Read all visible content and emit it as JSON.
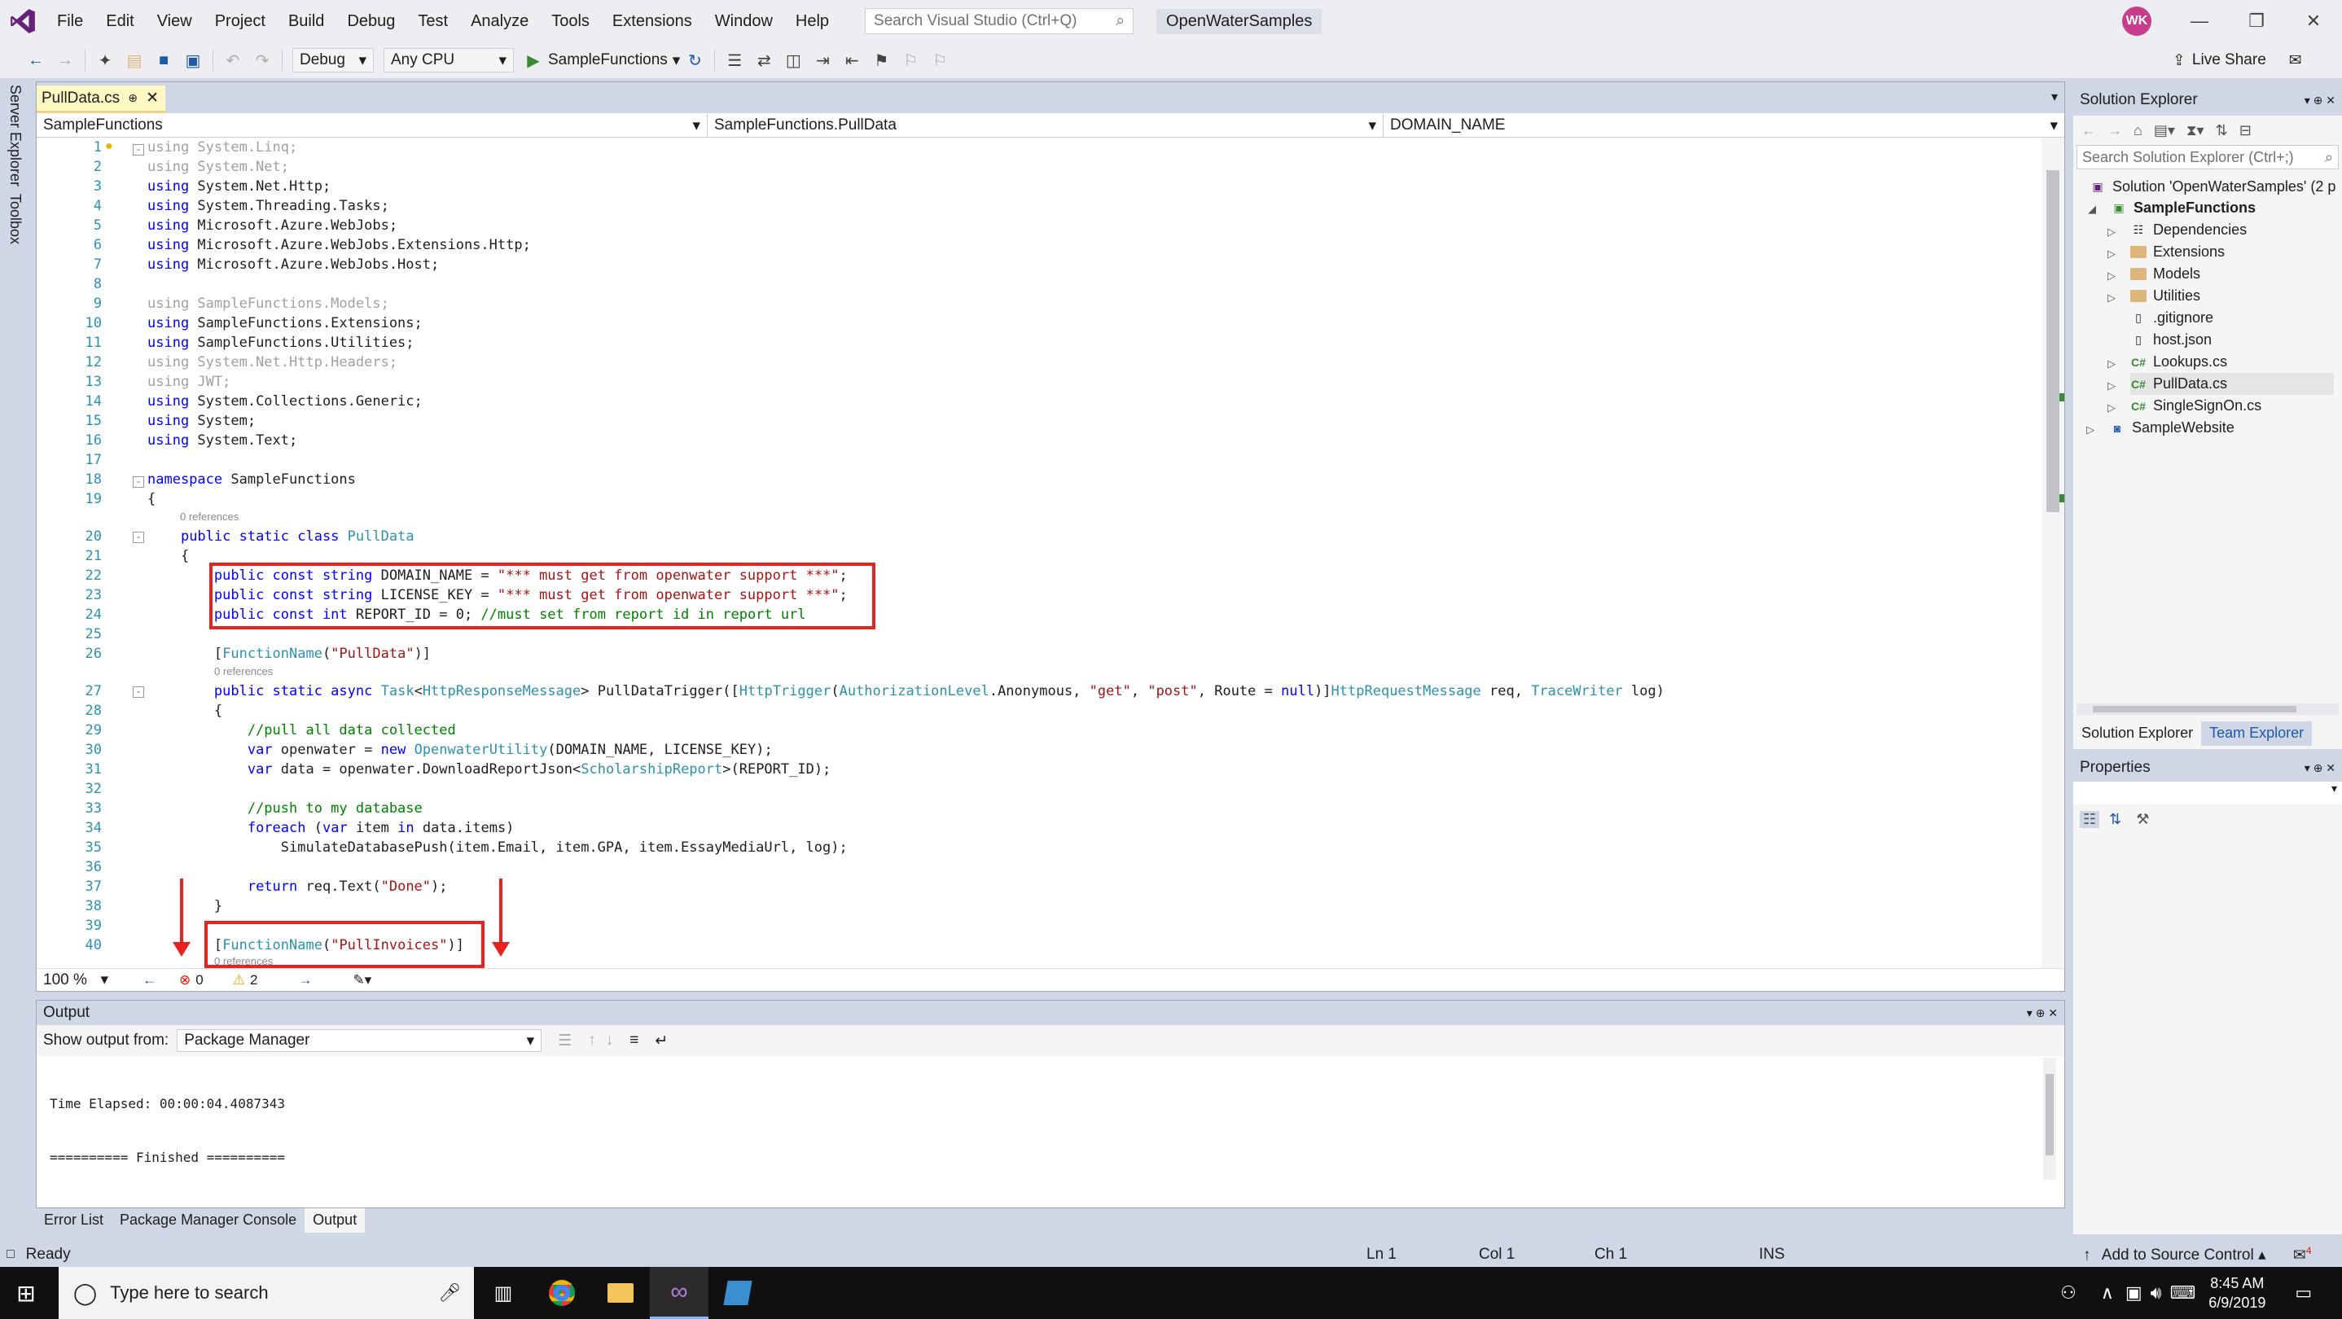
{
  "titlebar": {
    "menus": [
      "File",
      "Edit",
      "View",
      "Project",
      "Build",
      "Debug",
      "Test",
      "Analyze",
      "Tools",
      "Extensions",
      "Window",
      "Help"
    ],
    "search_placeholder": "Search Visual Studio (Ctrl+Q)",
    "solution_name": "OpenWaterSamples",
    "avatar_initials": "WK"
  },
  "toolbar": {
    "config": "Debug",
    "platform": "Any CPU",
    "run_target": "SampleFunctions",
    "live_share": "Live Share"
  },
  "left_tabs": [
    "Server Explorer",
    "Toolbox"
  ],
  "editor": {
    "tab_name": "PullData.cs",
    "nav_project": "SampleFunctions",
    "nav_class": "SampleFunctions.PullData",
    "nav_member": "DOMAIN_NAME",
    "zoom": "100 %",
    "errors": "0",
    "warnings": "2",
    "references_label": "0 references",
    "lines": [
      {
        "n": "1",
        "html": "<span class='dim'>using System.Linq;</span>"
      },
      {
        "n": "2",
        "html": "<span class='dim'>using System.Net;</span>"
      },
      {
        "n": "3",
        "html": "<span class='kw'>using</span> System.Net.Http;"
      },
      {
        "n": "4",
        "html": "<span class='kw'>using</span> System.Threading.Tasks;"
      },
      {
        "n": "5",
        "html": "<span class='kw'>using</span> Microsoft.Azure.WebJobs;"
      },
      {
        "n": "6",
        "html": "<span class='kw'>using</span> Microsoft.Azure.WebJobs.Extensions.Http;"
      },
      {
        "n": "7",
        "html": "<span class='kw'>using</span> Microsoft.Azure.WebJobs.Host;"
      },
      {
        "n": "8",
        "html": ""
      },
      {
        "n": "9",
        "html": "<span class='dim'>using SampleFunctions.Models;</span>"
      },
      {
        "n": "10",
        "html": "<span class='kw'>using</span> SampleFunctions.Extensions;"
      },
      {
        "n": "11",
        "html": "<span class='kw'>using</span> SampleFunctions.Utilities;"
      },
      {
        "n": "12",
        "html": "<span class='dim'>using System.Net.Http.Headers;</span>"
      },
      {
        "n": "13",
        "html": "<span class='dim'>using JWT;</span>"
      },
      {
        "n": "14",
        "html": "<span class='kw'>using</span> System.Collections.Generic;"
      },
      {
        "n": "15",
        "html": "<span class='kw'>using</span> System;"
      },
      {
        "n": "16",
        "html": "<span class='kw'>using</span> System.Text;"
      },
      {
        "n": "17",
        "html": ""
      },
      {
        "n": "18",
        "html": "<span class='kw'>namespace</span> SampleFunctions"
      },
      {
        "n": "19",
        "html": "{"
      },
      {
        "n": "20",
        "html": "    <span class='kw'>public static class</span> <span class='ty'>PullData</span>"
      },
      {
        "n": "21",
        "html": "    {"
      },
      {
        "n": "22",
        "html": "        <span class='kw'>public const string</span> DOMAIN_NAME = <span class='st'>\"*** must get from openwater support ***\"</span>;"
      },
      {
        "n": "23",
        "html": "        <span class='kw'>public const string</span> LICENSE_KEY = <span class='st'>\"*** must get from openwater support ***\"</span>;"
      },
      {
        "n": "24",
        "html": "        <span class='kw'>public const int</span> REPORT_ID = 0; <span class='cm'>//must set from report id in report url</span>"
      },
      {
        "n": "25",
        "html": ""
      },
      {
        "n": "26",
        "html": "        [<span class='ty'>FunctionName</span>(<span class='st'>\"PullData\"</span>)]"
      },
      {
        "n": "27",
        "html": "        <span class='kw'>public static async</span> <span class='ty'>Task</span>&lt;<span class='ty'>HttpResponseMessage</span>&gt; PullDataTrigger([<span class='ty'>HttpTrigger</span>(<span class='ty'>AuthorizationLevel</span>.Anonymous, <span class='st'>\"get\"</span>, <span class='st'>\"post\"</span>, Route = <span class='kw'>null</span>)]<span class='ty'>HttpRequestMessage</span> req, <span class='ty'>TraceWriter</span> log)"
      },
      {
        "n": "28",
        "html": "        {"
      },
      {
        "n": "29",
        "html": "            <span class='cm'>//pull all data collected</span>"
      },
      {
        "n": "30",
        "html": "            <span class='kw'>var</span> openwater = <span class='kw'>new</span> <span class='ty'>OpenwaterUtility</span>(DOMAIN_NAME, LICENSE_KEY);"
      },
      {
        "n": "31",
        "html": "            <span class='kw'>var</span> data = openwater.DownloadReportJson&lt;<span class='ty'>ScholarshipReport</span>&gt;(REPORT_ID);"
      },
      {
        "n": "32",
        "html": ""
      },
      {
        "n": "33",
        "html": "            <span class='cm'>//push to my database</span>"
      },
      {
        "n": "34",
        "html": "            <span class='kw'>foreach</span> (<span class='kw'>var</span> item <span class='kw'>in</span> data.items)"
      },
      {
        "n": "35",
        "html": "                SimulateDatabasePush(item.Email, item.GPA, item.EssayMediaUrl, log);"
      },
      {
        "n": "36",
        "html": ""
      },
      {
        "n": "37",
        "html": "            <span class='kw'>return</span> req.Text(<span class='st'>\"Done\"</span>);"
      },
      {
        "n": "38",
        "html": "        }"
      },
      {
        "n": "39",
        "html": ""
      },
      {
        "n": "40",
        "html": "        [<span class='ty'>FunctionName</span>(<span class='st'>\"PullInvoices\"</span>)]"
      }
    ]
  },
  "solution_explorer": {
    "title": "Solution Explorer",
    "search_placeholder": "Search Solution Explorer (Ctrl+;)",
    "solution_label": "Solution 'OpenWaterSamples' (2 p",
    "project": "SampleFunctions",
    "items": [
      "Dependencies",
      "Extensions",
      "Models",
      "Utilities",
      ".gitignore",
      "host.json",
      "Lookups.cs",
      "PullData.cs",
      "SingleSignOn.cs"
    ],
    "second_project": "SampleWebsite",
    "tabs": [
      "Solution Explorer",
      "Team Explorer"
    ]
  },
  "properties": {
    "title": "Properties"
  },
  "output": {
    "title": "Output",
    "show_from_label": "Show output from:",
    "source": "Package Manager",
    "line1": "Time Elapsed: 00:00:04.4087343",
    "line2": "========== Finished ==========",
    "tabs": [
      "Error List",
      "Package Manager Console",
      "Output"
    ]
  },
  "statusbar": {
    "ready": "Ready",
    "ln": "Ln 1",
    "col": "Col 1",
    "ch": "Ch 1",
    "ins": "INS",
    "source_control": "Add to Source Control",
    "notifications": "4"
  },
  "taskbar": {
    "search_placeholder": "Type here to search",
    "time": "8:45 AM",
    "date": "6/9/2019"
  }
}
